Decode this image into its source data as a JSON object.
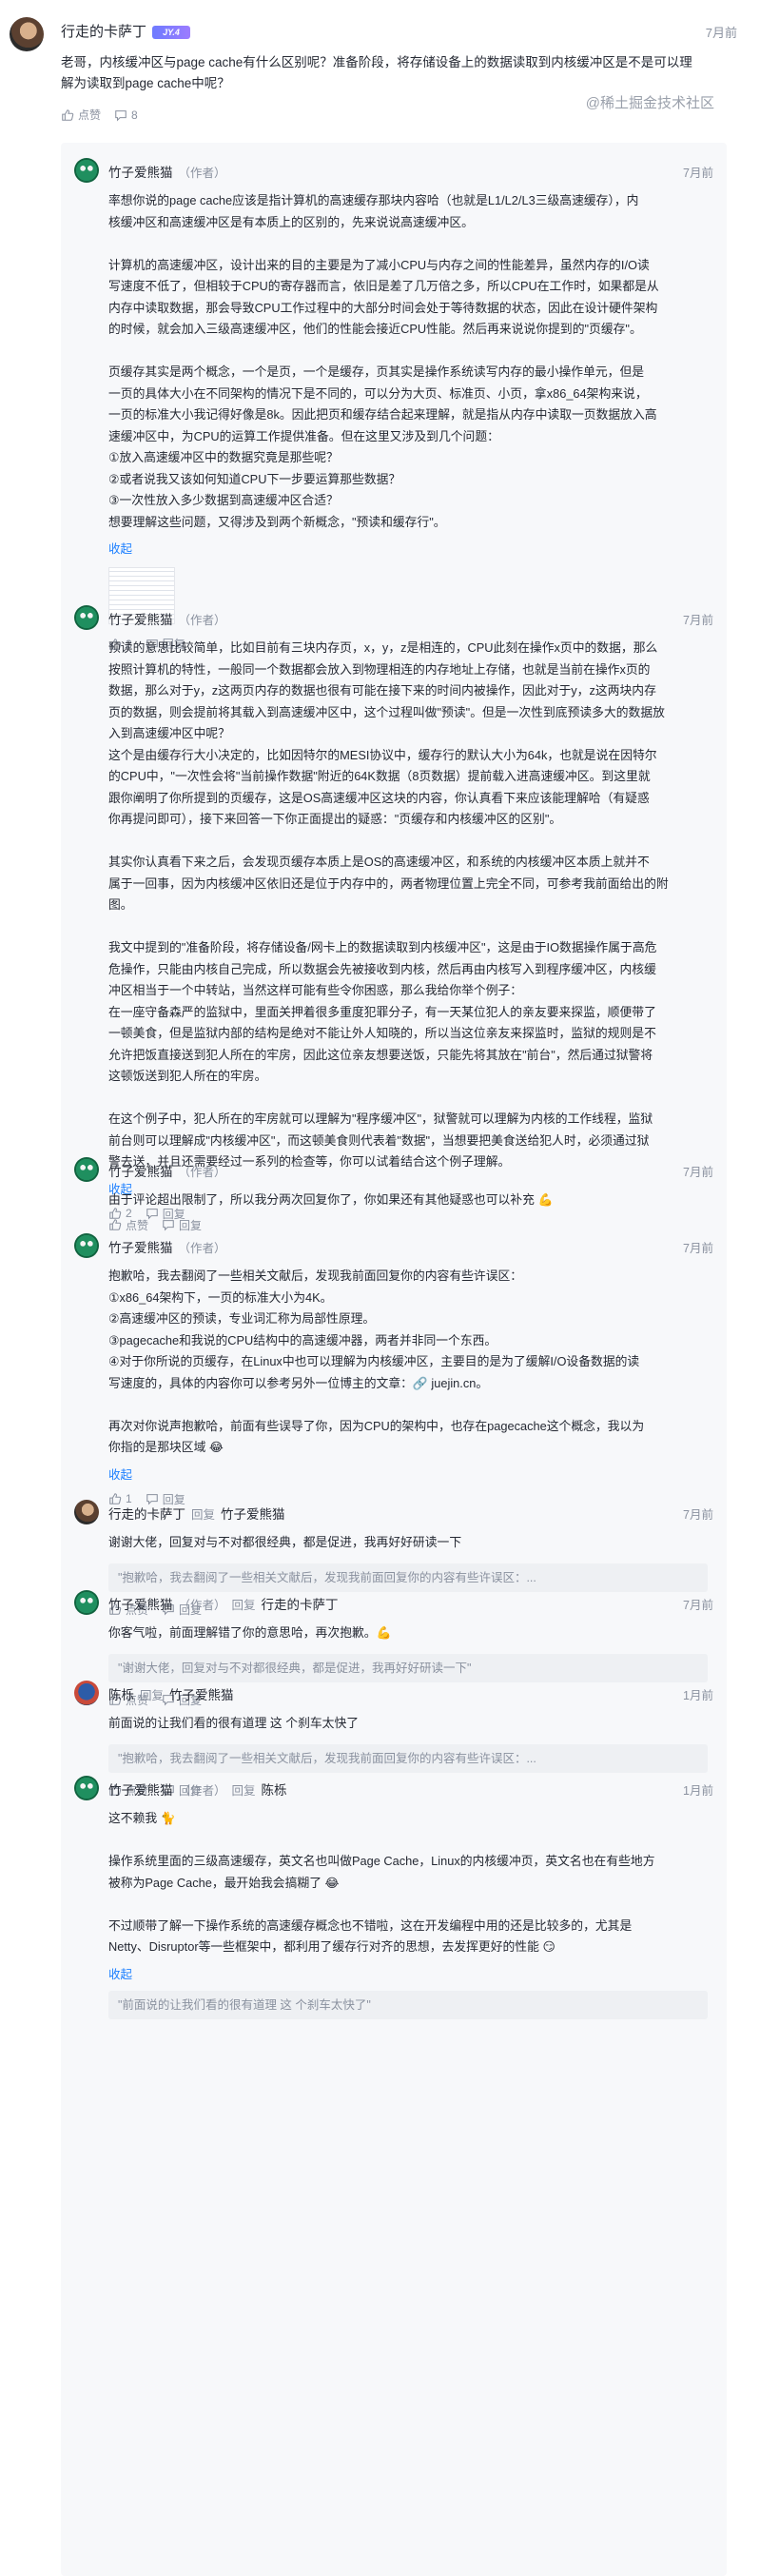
{
  "main": {
    "author": "行走的卡萨丁",
    "badge": "JY.4",
    "time": "7月前",
    "text_lines": [
      "老哥，内核缓冲区与page cache有什么区别呢？准备阶段，将存储设备上的数据读取到内核缓冲区是不是可以理",
      "解为读取到page cache中呢？"
    ],
    "like_label": "点赞",
    "reply_count": "8"
  },
  "replies": [
    {
      "author": "竹子爱熊猫",
      "author_tag": "（作者）",
      "time": "7月前",
      "paragraphs": [
        [
          "率想你说的page cache应该是指计算机的高速缓存那块内容哈（也就是L1/L2/L3三级高速缓存），内",
          "核缓冲区和高速缓冲区是有本质上的区别的，先来说说高速缓冲区。"
        ],
        [
          "计算机的高速缓冲区，设计出来的目的主要是为了减小CPU与内存之间的性能差异，虽然内存的I/O读",
          "写速度不低了，但相较于CPU的寄存器而言，依旧是差了几万倍之多，所以CPU在工作时，如果都是从",
          "内存中读取数据，那会导致CPU工作过程中的大部分时间会处于等待数据的状态，因此在设计硬件架构",
          "的时候，就会加入三级高速缓冲区，他们的性能会接近CPU性能。然后再来说说你提到的\"页缓存\"。"
        ],
        [
          "页缓存其实是两个概念，一个是页，一个是缓存，页其实是操作系统读写内存的最小操作单元，但是",
          "一页的具体大小在不同架构的情况下是不同的，可以分为大页、标准页、小页，拿x86_64架构来说，",
          "一页的标准大小我记得好像是8k。因此把页和缓存结合起来理解，就是指从内存中读取一页数据放入高",
          "速缓冲区中，为CPU的运算工作提供准备。但在这里又涉及到几个问题：",
          "①放入高速缓冲区中的数据究竟是那些呢？",
          "②或者说我又该如何知道CPU下一步要运算那些数据？",
          "③一次性放入多少数据到高速缓冲区合适？",
          "想要理解这些问题，又得涉及到两个新概念，\"预读和缓存行\"。"
        ]
      ],
      "collapse": "收起",
      "like_count": "2",
      "reply_label": "回复"
    },
    {
      "author": "竹子爱熊猫",
      "author_tag": "（作者）",
      "time": "7月前",
      "paragraphs": [
        [
          "预读的意思比较简单，比如目前有三块内存页，x，y，z是相连的，CPU此刻在操作x页中的数据，那么",
          "按照计算机的特性，一般同一个数据都会放入到物理相连的内存地址上存储，也就是当前在操作x页的",
          "数据，那么对于y，z这两页内存的数据也很有可能在接下来的时间内被操作，因此对于y，z这两块内存",
          "页的数据，则会提前将其载入到高速缓冲区中，这个过程叫做\"预读\"。但是一次性到底预读多大的数据放",
          "入到高速缓冲区中呢？",
          "这个是由缓存行大小决定的，比如因特尔的MESI协议中，缓存行的默认大小为64k，也就是说在因特尔",
          "的CPU中，\"一次性会将\"当前操作数据\"附近的64K数据（8页数据）提前载入进高速缓冲区。到这里就",
          "跟你阐明了你所提到的页缓存，这是OS高速缓冲区这块的内容，你认真看下来应该能理解哈（有疑惑",
          "你再提问即可），接下来回答一下你正面提出的疑惑：\"页缓存和内核缓冲区的区别\"。"
        ],
        [
          "其实你认真看下来之后，会发现页缓存本质上是OS的高速缓冲区，和系统的内核缓冲区本质上就并不",
          "属于一回事，因为内核缓冲区依旧还是位于内存中的，两者物理位置上完全不同，可参考我前面给出的附",
          "图。"
        ],
        [
          "我文中提到的\"准备阶段，将存储设备/网卡上的数据读取到内核缓冲区\"，这是由于IO数据操作属于高危",
          "危操作，只能由内核自己完成，所以数据会先被接收到内核，然后再由内核写入到程序缓冲区，内核缓",
          "冲区相当于一个中转站，当然这样可能有些令你困惑，那么我给你举个例子：",
          "在一座守备森严的监狱中，里面关押着很多重度犯罪分子，有一天某位犯人的亲友要来探监，顺便带了",
          "一顿美食，但是监狱内部的结构是绝对不能让外人知晓的，所以当这位亲友来探监时，监狱的规则是不",
          "允许把饭直接送到犯人所在的牢房，因此这位亲友想要送饭，只能先将其放在\"前台\"，然后通过狱警将",
          "这顿饭送到犯人所在的牢房。"
        ],
        [
          "在这个例子中，犯人所在的牢房就可以理解为\"程序缓冲区\"，狱警就可以理解为内核的工作线程，监狱",
          "前台则可以理解成\"内核缓冲区\"，而这顿美食则代表着\"数据\"，当想要把美食送给犯人时，必须通过狱",
          "警去送，并且还需要经过一系列的检查等，你可以试着结合这个例子理解。"
        ]
      ],
      "collapse": "收起",
      "like_count": "2",
      "reply_label": "回复"
    },
    {
      "author": "竹子爱熊猫",
      "author_tag": "（作者）",
      "time": "7月前",
      "paragraphs": [
        [
          "由于评论超出限制了，所以我分两次回复你了，你如果还有其他疑惑也可以补充 💪"
        ]
      ],
      "like_label": "点赞",
      "reply_label": "回复"
    },
    {
      "author": "竹子爱熊猫",
      "author_tag": "（作者）",
      "time": "7月前",
      "paragraphs": [
        [
          "抱歉哈，我去翻阅了一些相关文献后，发现我前面回复你的内容有些许误区：",
          "①x86_64架构下，一页的标准大小为4K。",
          "②高速缓冲区的预读，专业词汇称为局部性原理。",
          "③pagecache和我说的CPU结构中的高速缓冲器，两者并非同一个东西。",
          "④对于你所说的页缓存，在Linux中也可以理解为内核缓冲区，主要目的是为了缓解I/O设备数据的读",
          "写速度的，具体的内容你可以参考另外一位博主的文章：🔗 juejin.cn。"
        ],
        [
          "再次对你说声抱歉哈，前面有些误导了你，因为CPU的架构中，也存在pagecache这个概念，我以为",
          "你指的是那块区域 😂"
        ]
      ],
      "collapse": "收起",
      "like_count": "1",
      "reply_label": "回复"
    },
    {
      "author": "行走的卡萨丁",
      "reply_word": "回复",
      "target": "竹子爱熊猫",
      "time": "7月前",
      "paragraphs": [
        [
          "谢谢大佬，回复对与不对都很经典，都是促进，我再好好研读一下"
        ]
      ],
      "quote": "\"抱歉哈，我去翻阅了一些相关文献后，发现我前面回复你的内容有些许误区：...",
      "like_label": "点赞",
      "reply_label": "回复"
    },
    {
      "author": "竹子爱熊猫",
      "author_tag": "（作者）",
      "reply_word": "回复",
      "target": "行走的卡萨丁",
      "time": "7月前",
      "paragraphs": [
        [
          "你客气啦，前面理解错了你的意思哈，再次抱歉。💪"
        ]
      ],
      "quote": "\"谢谢大佬，回复对与不对都很经典，都是促进，我再好好研读一下\"",
      "like_label": "点赞",
      "reply_label": "回复"
    },
    {
      "author": "陈栎",
      "reply_word": "回复",
      "target": "竹子爱熊猫",
      "time": "1月前",
      "paragraphs": [
        [
          "前面说的让我们看的很有道理 这 个刹车太快了"
        ]
      ],
      "quote": "\"抱歉哈，我去翻阅了一些相关文献后，发现我前面回复你的内容有些许误区：...",
      "like_label": "点赞",
      "reply_label": "回复"
    },
    {
      "author": "竹子爱熊猫",
      "author_tag": "（作者）",
      "reply_word": "回复",
      "target": "陈栎",
      "time": "1月前",
      "paragraphs": [
        [
          "这不赖我 🐈"
        ],
        [
          "操作系统里面的三级高速缓存，英文名也叫做Page Cache，Linux的内核缓冲页，英文名也在有些地方",
          "被称为Page Cache，最开始我会搞糊了 😂"
        ],
        [
          "不过顺带了解一下操作系统的高速缓存概念也不错啦，这在开发编程中用的还是比较多的，尤其是",
          "Netty、Disruptor等一些框架中，都利用了缓存行对齐的思想，去发挥更好的性能 😏"
        ]
      ],
      "collapse": "收起",
      "quote": "\"前面说的让我们看的很有道理 这 个刹车太快了\""
    }
  ],
  "watermark": "@稀土掘金技术社区"
}
